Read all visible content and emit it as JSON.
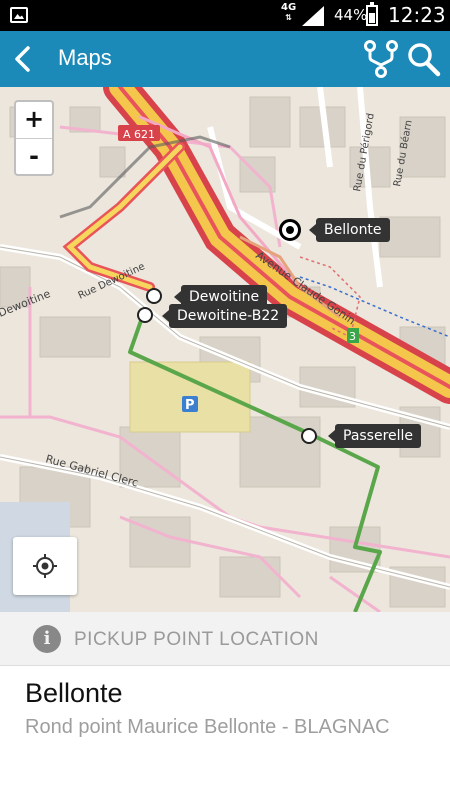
{
  "status_bar": {
    "network": "4G",
    "battery_percent": "44%",
    "time": "12:23",
    "icons": [
      "image-icon",
      "signal-icon",
      "battery-icon"
    ]
  },
  "app_bar": {
    "title": "Maps",
    "icons": [
      "back-arrow-icon",
      "route-fork-icon",
      "search-icon"
    ],
    "color": "#1c8ab8"
  },
  "map": {
    "zoom_in": "+",
    "zoom_out": "-",
    "road_labels": [
      "A 621",
      "Dewoitine",
      "Avenue Claude Gonin",
      "Rue du Périgord",
      "Rue du Béarn",
      "Rue Gabriel Clerc",
      "Rue Dewoitine",
      "3",
      "P"
    ],
    "stops": [
      {
        "name": "Bellonte",
        "selected": true
      },
      {
        "name": "Dewoitine",
        "selected": false
      },
      {
        "name": "Dewoitine-B22",
        "selected": false
      },
      {
        "name": "Passerelle",
        "selected": false
      }
    ],
    "route_color": "#5aa64a"
  },
  "pickup": {
    "header": "PICKUP POINT LOCATION",
    "name": "Bellonte",
    "address": "Rond point Maurice Bellonte - BLAGNAC"
  }
}
